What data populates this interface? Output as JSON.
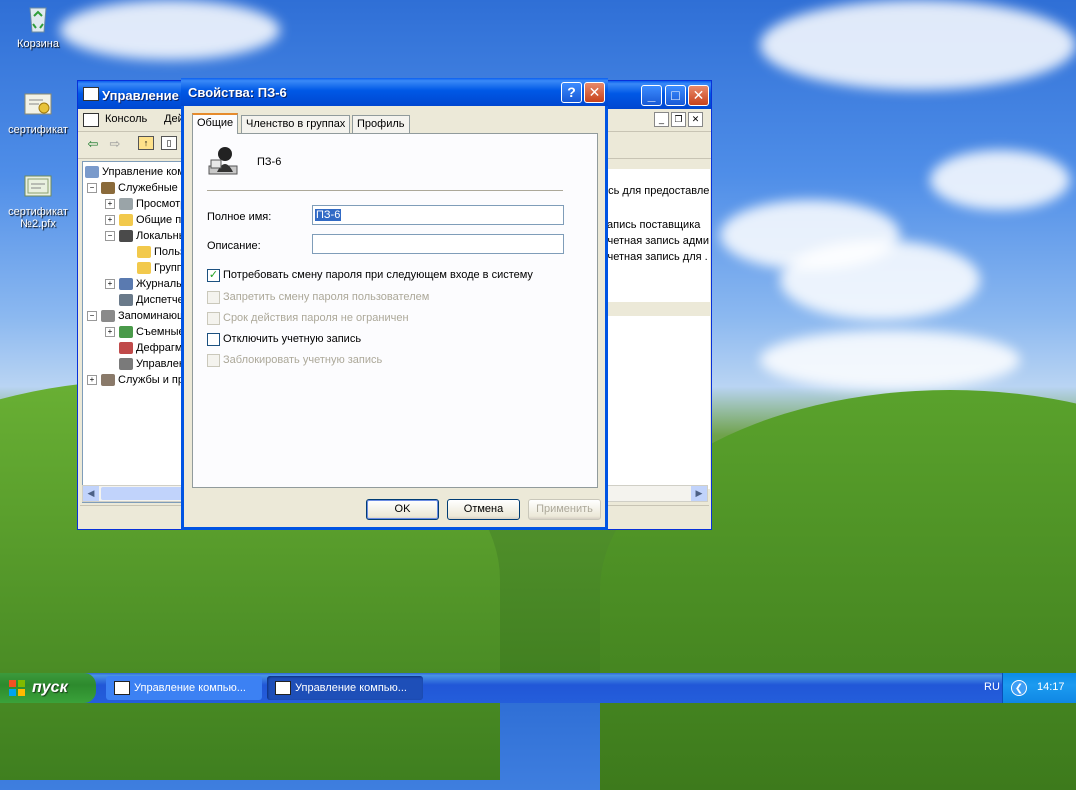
{
  "desktop": {
    "icons": [
      {
        "label": "Корзина",
        "icon": "recycle-bin-icon"
      },
      {
        "label": "сертификат",
        "icon": "certificate-icon"
      },
      {
        "label": "сертификат №2.pfx",
        "icon": "certificate-icon"
      }
    ]
  },
  "back_window": {
    "title": "Управление компьютером",
    "menu": [
      "Консоль",
      "Действие"
    ],
    "tree": [
      "Управление компьютером",
      "Служебные программы",
      "Просмотр событий",
      "Общие папки",
      "Локальные пользователи",
      "Пользователи",
      "Группы",
      "Журналы производительности",
      "Диспетчер устройств",
      "Запоминающие устройства",
      "Съемные ЗУ",
      "Дефрагментация диска",
      "Управление дисками",
      "Службы и приложения"
    ],
    "right_lines": [
      "ись для предоставле",
      "запись поставщика",
      "учетная запись адми",
      "учетная запись для ."
    ]
  },
  "dialog": {
    "title": "Свойства: ПЗ-6",
    "help_label": "?",
    "close_label": "✕",
    "tabs": [
      "Общие",
      "Членство в группах",
      "Профиль"
    ],
    "user_name": "ПЗ-6",
    "full_name_label": "Полное имя:",
    "full_name_value": "ПЗ-6",
    "description_label": "Описание:",
    "description_value": "",
    "checkboxes": [
      {
        "label": "Потребовать смену пароля при следующем входе в систему",
        "checked": true,
        "enabled": true
      },
      {
        "label": "Запретить смену пароля пользователем",
        "checked": false,
        "enabled": false
      },
      {
        "label": "Срок действия пароля не ограничен",
        "checked": false,
        "enabled": false
      },
      {
        "label": "Отключить учетную запись",
        "checked": false,
        "enabled": true
      },
      {
        "label": "Заблокировать учетную запись",
        "checked": false,
        "enabled": false
      }
    ],
    "buttons": {
      "ok": "OK",
      "cancel": "Отмена",
      "apply": "Применить"
    }
  },
  "taskbar": {
    "start_label": "пуск",
    "tasks": [
      "Управление компью...",
      "Управление компью..."
    ],
    "language": "RU",
    "clock": "14:17"
  }
}
